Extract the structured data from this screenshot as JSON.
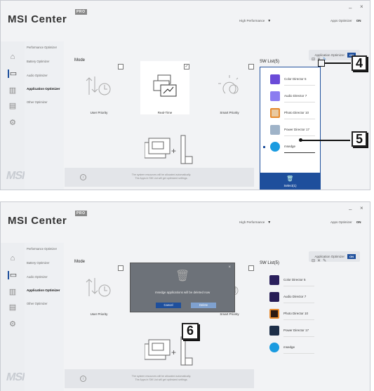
{
  "app": {
    "brand": "MSI Center",
    "edition_badge": "PRO",
    "mode_select": "High Performance",
    "apps_optimizer_label": "Apps Optimizer",
    "apps_optimizer_state": "ON"
  },
  "menu": [
    {
      "label": "Performance Optimizer",
      "active": false
    },
    {
      "label": "Battery Optimizer",
      "active": false
    },
    {
      "label": "Audio Optimizer",
      "active": false
    },
    {
      "label": "Application Optimizer",
      "active": true
    },
    {
      "label": "Other Optimizer",
      "active": false
    }
  ],
  "rail_icons": [
    "home-icon",
    "monitor-icon",
    "chart-icon",
    "briefcase-icon",
    "gear-icon"
  ],
  "content": {
    "mode_title": "Mode",
    "app_optimizer_toggle_label": "Application Optimizer",
    "app_optimizer_toggle_state": "ON",
    "cards": [
      {
        "label": "User Priority",
        "checked": false
      },
      {
        "label": "Real-Time",
        "checked": true
      },
      {
        "label": "Smart Priority",
        "checked": false
      }
    ],
    "footer_line1": "The system resources will be allocated automatically.",
    "footer_line2": "The Apps in SW List will get optimized settings."
  },
  "sw_list": {
    "title": "SW List(5)",
    "items": [
      {
        "name": "Color Director 5",
        "color": "#6a4bd8"
      },
      {
        "name": "Audio Director 7",
        "color": "#7b6cf0"
      },
      {
        "name": "Photo Director 10",
        "color": "#e68a2e"
      },
      {
        "name": "Power Director 17",
        "color": "#3f7fd1"
      },
      {
        "name": "msedge",
        "color": "#1a9be0"
      }
    ],
    "select_button": "Select(1)"
  },
  "modal": {
    "message": "msedge applications will be deleted now",
    "cancel": "Cancel",
    "delete": "Delete"
  },
  "callouts": [
    "4",
    "5",
    "6"
  ],
  "colors": {
    "accent": "#1e4f9c"
  }
}
